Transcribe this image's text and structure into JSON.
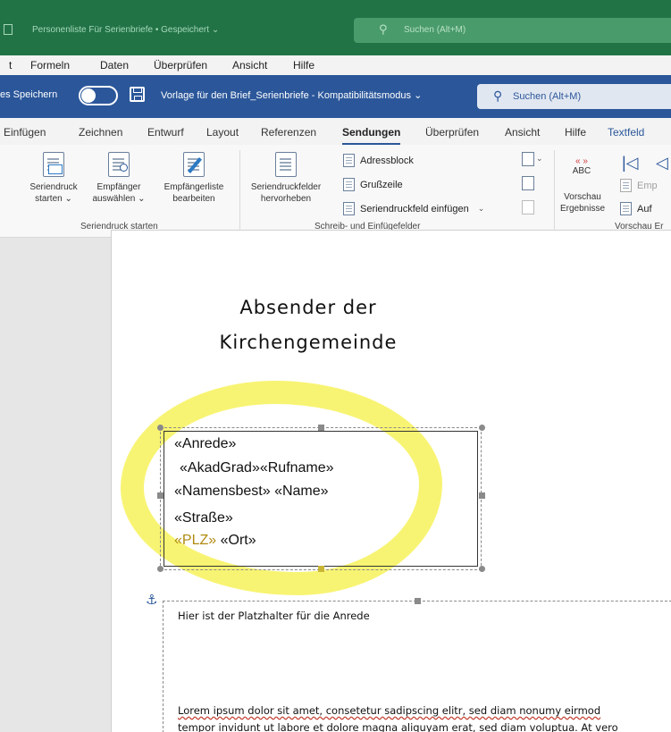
{
  "excel": {
    "doc_title": "Personenliste Für Serienbriefe • Gespeichert ⌄",
    "search_placeholder": "Suchen (Alt+M)",
    "menu": [
      "t",
      "Formeln",
      "Daten",
      "Überprüfen",
      "Ansicht",
      "Hilfe"
    ]
  },
  "word": {
    "autosave_label": "es Speichern",
    "doc_title": "Vorlage für den Brief_Serienbriefe  -  Kompatibilitätsmodus ⌄",
    "search_placeholder": "Suchen (Alt+M)"
  },
  "tabs": {
    "items": [
      "Einfügen",
      "Zeichnen",
      "Entwurf",
      "Layout",
      "Referenzen",
      "Sendungen",
      "Überprüfen",
      "Ansicht",
      "Hilfe",
      "Textfeld"
    ],
    "active": "Sendungen"
  },
  "ribbon": {
    "seriendruck_starten": [
      "Seriendruck",
      "starten ⌄"
    ],
    "empfaenger_auswaehlen": [
      "Empfänger",
      "auswählen ⌄"
    ],
    "empfaengerliste_bearbeiten": [
      "Empfängerliste",
      "bearbeiten"
    ],
    "group1_label": "Seriendruck starten",
    "seriendruckfelder": [
      "Seriendruckfelder",
      "hervorheben"
    ],
    "adressblock": "Adressblock",
    "grusszeile": "Grußzeile",
    "feld_einfuegen": "Seriendruckfeld einfügen",
    "group2_label": "Schreib- und Einfügefelder",
    "vorschau": [
      "Vorschau",
      "Ergebnisse"
    ],
    "abc": "ABC",
    "empf_partial": "Emp",
    "auf_partial": "Auf",
    "group3_label": "Vorschau Er"
  },
  "document": {
    "sender_line1": "Absender der",
    "sender_line2": "Kirchengemeinde",
    "fields": {
      "anrede": "«Anrede»",
      "akadgrad_rufname": "«AkadGrad»«Rufname»",
      "namensbest_name": "«Namensbest» «Name»",
      "strasse": "«Straße»",
      "plz": "«PLZ»",
      "ort": "«Ort»"
    },
    "placeholder_text": "Hier ist der Platzhalter für die Anrede",
    "lorem_line1": "Lorem ipsum dolor sit amet, consetetur sadipscing elitr, sed diam nonumy eirmod",
    "lorem_line2": "tempor invidunt ut labore et dolore magna aliquyam erat, sed diam voluptua. At vero"
  },
  "colors": {
    "excel_green": "#217346",
    "word_blue": "#2b579a",
    "highlight_yellow": "#f7f25a"
  }
}
